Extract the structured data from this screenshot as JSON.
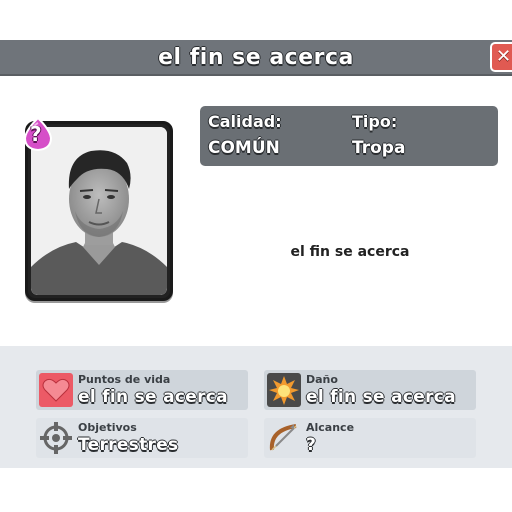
{
  "title": "el fin se acerca",
  "close_glyph": "✕",
  "elixir_cost": "?",
  "info": {
    "quality_label": "Calidad:",
    "quality_value": "COMÚN",
    "type_label": "Tipo:",
    "type_value": "Tropa"
  },
  "description": "el fin se acerca",
  "stats": {
    "hitpoints": {
      "label": "Puntos de vida",
      "value": "el fin se acerca",
      "icon": "heart-icon"
    },
    "damage": {
      "label": "Daño",
      "value": "el fin se acerca",
      "icon": "explosion-icon"
    },
    "targets": {
      "label": "Objetivos",
      "value": "Terrestres",
      "icon": "crosshair-icon"
    },
    "range": {
      "label": "Alcance",
      "value": "?",
      "icon": "bow-icon"
    }
  },
  "colors": {
    "title_bar": "#6f747a",
    "close_button": "#e05a52",
    "elixir": "#d64fc8",
    "info_panel": "#6a6f74"
  }
}
